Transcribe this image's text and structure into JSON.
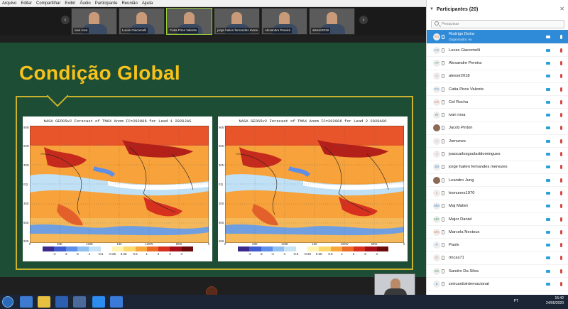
{
  "menu": [
    "Arquivo",
    "Editar",
    "Compartilhar",
    "Exibir",
    "Áudio",
    "Participante",
    "Reunião",
    "Ajuda"
  ],
  "video_strip": {
    "prev_icon": "chevron-left-icon",
    "next_icon": "chevron-right-icon",
    "tiles": [
      {
        "name": "ivan rosa"
      },
      {
        "name": "Lucas Giacomelli"
      },
      {
        "name": "Catia Pires Valente"
      },
      {
        "name": "jorge hailen fernandes mene..."
      },
      {
        "name": "Alexandre Pereira"
      },
      {
        "name": "alessir2018"
      }
    ],
    "active_tile": 2
  },
  "slide": {
    "title": "Condição Global",
    "maps": [
      {
        "caption": "NASA GEOS5v2 Forecast of TMAX Anom IC=202006 for Lead 1 2020JAS"
      },
      {
        "caption": "NASA GEOS5v2 Forecast of TMAX Anom IC=202006 for Lead 2 2020ASO"
      }
    ],
    "colorbar_ticks": [
      "-4",
      "-3",
      "-2",
      "-1",
      "-0.5",
      "-0.25",
      "0.25",
      "0.5",
      "1",
      "2",
      "3",
      "4"
    ],
    "colorbar_colors": [
      "#3b2a8a",
      "#3f5bd0",
      "#5d8ee8",
      "#8ec0f2",
      "#c6e2f7",
      "#ffffff",
      "#fff3b0",
      "#fdd86a",
      "#f8a83a",
      "#ec6a25",
      "#d7301f",
      "#a50f15",
      "#6b0a0a"
    ],
    "lat_labels": [
      "90N",
      "60N",
      "30N",
      "EQ",
      "30S",
      "60S",
      "90S"
    ],
    "lon_labels": [
      "0",
      "60E",
      "120E",
      "180",
      "120W",
      "60W",
      "0"
    ]
  },
  "panel": {
    "title": "Participantes (20)",
    "close_icon": "close-icon",
    "search_placeholder": "Pesquisar",
    "participants": [
      {
        "initials": "RD",
        "name": "Rodrigo Dutra",
        "sub": "Organizador, eu",
        "selected": true
      },
      {
        "initials": "LG",
        "name": "Lucas Giacomelli"
      },
      {
        "initials": "AP",
        "name": "Alexandre Pereira"
      },
      {
        "initials": "A",
        "name": "alessir2018"
      },
      {
        "initials": "CV",
        "name": "Catia Pires Valente"
      },
      {
        "initials": "CR",
        "name": "Cel Rocha"
      },
      {
        "initials": "IR",
        "name": "ivan rosa"
      },
      {
        "initials": "",
        "name": "Jacob Pinton",
        "photo": true
      },
      {
        "initials": "J",
        "name": "Jornunes"
      },
      {
        "initials": "J",
        "name": "joaocarlosgoulartdomingues"
      },
      {
        "initials": "JM",
        "name": "jorge hailen fernandes menezes"
      },
      {
        "initials": "",
        "name": "Leandro Jung",
        "photo": true
      },
      {
        "initials": "L",
        "name": "leonunes1970"
      },
      {
        "initials": "MM",
        "name": "Maj Mattei"
      },
      {
        "initials": "MD",
        "name": "Major Daniel"
      },
      {
        "initials": "MN",
        "name": "Marcela Nectoux"
      },
      {
        "initials": "P",
        "name": "Paolx"
      },
      {
        "initials": "R",
        "name": "rincas71"
      },
      {
        "initials": "SS",
        "name": "Sandro Da Silva"
      },
      {
        "initials": "Z",
        "name": "zericardointernacional"
      }
    ]
  },
  "taskbar": {
    "language": "PT",
    "time": "16:42",
    "date": "24/06/2020"
  }
}
